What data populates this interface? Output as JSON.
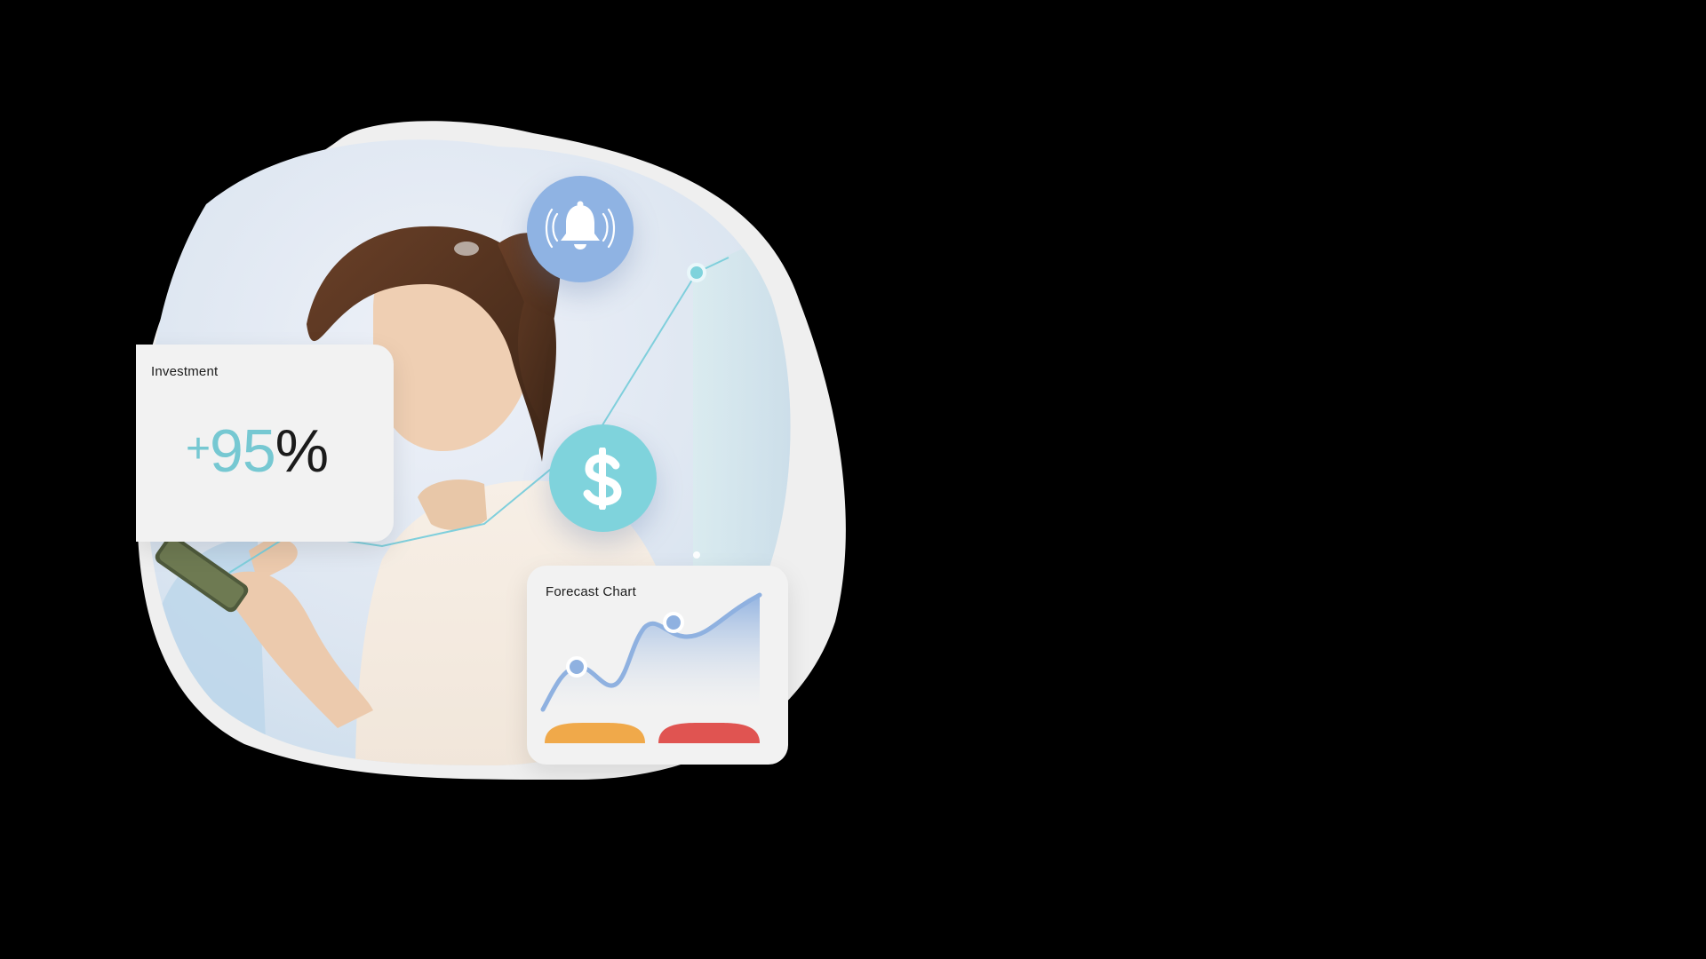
{
  "investment_card": {
    "title": "Investment",
    "value_sign": "+",
    "value_number": "95",
    "value_unit": "%"
  },
  "forecast_card": {
    "title": "Forecast Chart"
  },
  "icons": {
    "notification": "bell-icon",
    "money": "dollar-icon",
    "photo": "woman-with-phone-photo"
  },
  "colors": {
    "accent_teal": "#76c8d2",
    "bell_blue": "#8fb3e3",
    "chart_blue": "#8fb1e0",
    "bar_orange": "#f0a94a",
    "bar_red": "#e05451"
  }
}
